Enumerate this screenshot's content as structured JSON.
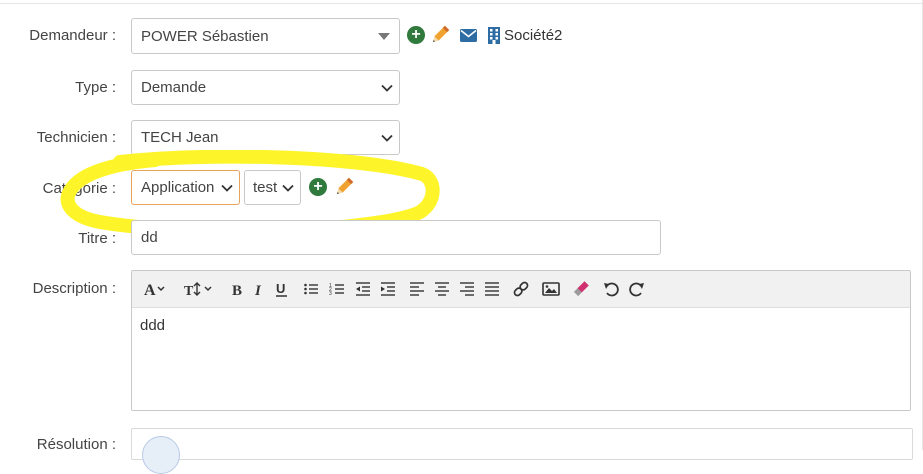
{
  "labels": {
    "requester": "Demandeur :",
    "type": "Type :",
    "technician": "Technicien :",
    "category": "Catégorie :",
    "title": "Titre :",
    "description": "Description :",
    "resolution": "Résolution :"
  },
  "requester": {
    "value": "POWER Sébastien",
    "company": "Société2"
  },
  "type": {
    "value": "Demande"
  },
  "technician": {
    "value": "TECH Jean"
  },
  "category": {
    "value": "Application",
    "subcategory": "test"
  },
  "title": {
    "value": "dd"
  },
  "description": {
    "text": "ddd",
    "toolbar": [
      "font-icon",
      "text-height-icon",
      "bold-icon",
      "italic-icon",
      "underline-icon",
      "bullet-list-icon",
      "numbered-list-icon",
      "outdent-icon",
      "indent-icon",
      "align-left-icon",
      "align-center-icon",
      "align-right-icon",
      "justify-icon",
      "link-icon",
      "image-icon",
      "eraser-icon",
      "undo-icon",
      "redo-icon"
    ]
  },
  "colors": {
    "add_green": "#2f7a3c",
    "pencil_orange": "#f0a22e",
    "mail_blue": "#2e6da4",
    "highlight_yellow": "#fdf52a",
    "focus_border": "#e8a35e"
  }
}
